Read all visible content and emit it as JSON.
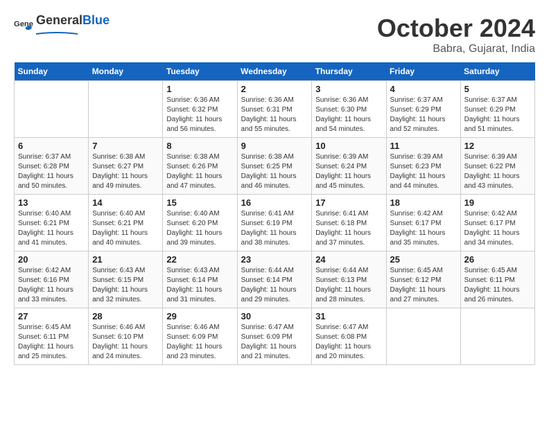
{
  "header": {
    "logo_general": "General",
    "logo_blue": "Blue",
    "month": "October 2024",
    "location": "Babra, Gujarat, India"
  },
  "weekdays": [
    "Sunday",
    "Monday",
    "Tuesday",
    "Wednesday",
    "Thursday",
    "Friday",
    "Saturday"
  ],
  "weeks": [
    [
      {
        "day": "",
        "info": ""
      },
      {
        "day": "",
        "info": ""
      },
      {
        "day": "1",
        "info": "Sunrise: 6:36 AM\nSunset: 6:32 PM\nDaylight: 11 hours and 56 minutes."
      },
      {
        "day": "2",
        "info": "Sunrise: 6:36 AM\nSunset: 6:31 PM\nDaylight: 11 hours and 55 minutes."
      },
      {
        "day": "3",
        "info": "Sunrise: 6:36 AM\nSunset: 6:30 PM\nDaylight: 11 hours and 54 minutes."
      },
      {
        "day": "4",
        "info": "Sunrise: 6:37 AM\nSunset: 6:29 PM\nDaylight: 11 hours and 52 minutes."
      },
      {
        "day": "5",
        "info": "Sunrise: 6:37 AM\nSunset: 6:29 PM\nDaylight: 11 hours and 51 minutes."
      }
    ],
    [
      {
        "day": "6",
        "info": "Sunrise: 6:37 AM\nSunset: 6:28 PM\nDaylight: 11 hours and 50 minutes."
      },
      {
        "day": "7",
        "info": "Sunrise: 6:38 AM\nSunset: 6:27 PM\nDaylight: 11 hours and 49 minutes."
      },
      {
        "day": "8",
        "info": "Sunrise: 6:38 AM\nSunset: 6:26 PM\nDaylight: 11 hours and 47 minutes."
      },
      {
        "day": "9",
        "info": "Sunrise: 6:38 AM\nSunset: 6:25 PM\nDaylight: 11 hours and 46 minutes."
      },
      {
        "day": "10",
        "info": "Sunrise: 6:39 AM\nSunset: 6:24 PM\nDaylight: 11 hours and 45 minutes."
      },
      {
        "day": "11",
        "info": "Sunrise: 6:39 AM\nSunset: 6:23 PM\nDaylight: 11 hours and 44 minutes."
      },
      {
        "day": "12",
        "info": "Sunrise: 6:39 AM\nSunset: 6:22 PM\nDaylight: 11 hours and 43 minutes."
      }
    ],
    [
      {
        "day": "13",
        "info": "Sunrise: 6:40 AM\nSunset: 6:21 PM\nDaylight: 11 hours and 41 minutes."
      },
      {
        "day": "14",
        "info": "Sunrise: 6:40 AM\nSunset: 6:21 PM\nDaylight: 11 hours and 40 minutes."
      },
      {
        "day": "15",
        "info": "Sunrise: 6:40 AM\nSunset: 6:20 PM\nDaylight: 11 hours and 39 minutes."
      },
      {
        "day": "16",
        "info": "Sunrise: 6:41 AM\nSunset: 6:19 PM\nDaylight: 11 hours and 38 minutes."
      },
      {
        "day": "17",
        "info": "Sunrise: 6:41 AM\nSunset: 6:18 PM\nDaylight: 11 hours and 37 minutes."
      },
      {
        "day": "18",
        "info": "Sunrise: 6:42 AM\nSunset: 6:17 PM\nDaylight: 11 hours and 35 minutes."
      },
      {
        "day": "19",
        "info": "Sunrise: 6:42 AM\nSunset: 6:17 PM\nDaylight: 11 hours and 34 minutes."
      }
    ],
    [
      {
        "day": "20",
        "info": "Sunrise: 6:42 AM\nSunset: 6:16 PM\nDaylight: 11 hours and 33 minutes."
      },
      {
        "day": "21",
        "info": "Sunrise: 6:43 AM\nSunset: 6:15 PM\nDaylight: 11 hours and 32 minutes."
      },
      {
        "day": "22",
        "info": "Sunrise: 6:43 AM\nSunset: 6:14 PM\nDaylight: 11 hours and 31 minutes."
      },
      {
        "day": "23",
        "info": "Sunrise: 6:44 AM\nSunset: 6:14 PM\nDaylight: 11 hours and 29 minutes."
      },
      {
        "day": "24",
        "info": "Sunrise: 6:44 AM\nSunset: 6:13 PM\nDaylight: 11 hours and 28 minutes."
      },
      {
        "day": "25",
        "info": "Sunrise: 6:45 AM\nSunset: 6:12 PM\nDaylight: 11 hours and 27 minutes."
      },
      {
        "day": "26",
        "info": "Sunrise: 6:45 AM\nSunset: 6:11 PM\nDaylight: 11 hours and 26 minutes."
      }
    ],
    [
      {
        "day": "27",
        "info": "Sunrise: 6:45 AM\nSunset: 6:11 PM\nDaylight: 11 hours and 25 minutes."
      },
      {
        "day": "28",
        "info": "Sunrise: 6:46 AM\nSunset: 6:10 PM\nDaylight: 11 hours and 24 minutes."
      },
      {
        "day": "29",
        "info": "Sunrise: 6:46 AM\nSunset: 6:09 PM\nDaylight: 11 hours and 23 minutes."
      },
      {
        "day": "30",
        "info": "Sunrise: 6:47 AM\nSunset: 6:09 PM\nDaylight: 11 hours and 21 minutes."
      },
      {
        "day": "31",
        "info": "Sunrise: 6:47 AM\nSunset: 6:08 PM\nDaylight: 11 hours and 20 minutes."
      },
      {
        "day": "",
        "info": ""
      },
      {
        "day": "",
        "info": ""
      }
    ]
  ]
}
